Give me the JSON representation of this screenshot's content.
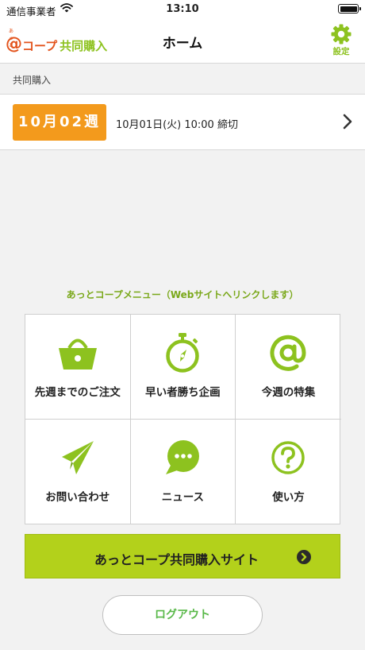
{
  "statusbar": {
    "carrier": "通信事業者",
    "time": "13:10"
  },
  "navbar": {
    "logo_ruby": "あっと",
    "logo_at": "@",
    "logo_coop": "コープ",
    "logo_sub": "共同購入",
    "title": "ホーム",
    "settings_label": "設定"
  },
  "section": {
    "header": "共同購入"
  },
  "week": {
    "badge": "10月02週",
    "deadline": "10月01日(火) 10:00 締切"
  },
  "menu": {
    "caption": "あっとコープメニュー（Webサイトへリンクします）",
    "items": [
      {
        "label": "先週までのご注文",
        "icon": "basket-icon"
      },
      {
        "label": "早い者勝ち企画",
        "icon": "stopwatch-icon"
      },
      {
        "label": "今週の特集",
        "icon": "at-sign-icon"
      },
      {
        "label": "お問い合わせ",
        "icon": "paper-plane-icon"
      },
      {
        "label": "ニュース",
        "icon": "speech-bubble-icon"
      },
      {
        "label": "使い方",
        "icon": "question-icon"
      }
    ]
  },
  "site_button": {
    "label": "あっとコープ共同購入サイト"
  },
  "logout_button": {
    "label": "ログアウト"
  },
  "colors": {
    "accent_green": "#8dc21f",
    "badge_orange": "#f39a1c",
    "button_green": "#b3d11b",
    "logo_orange": "#e3531c"
  }
}
